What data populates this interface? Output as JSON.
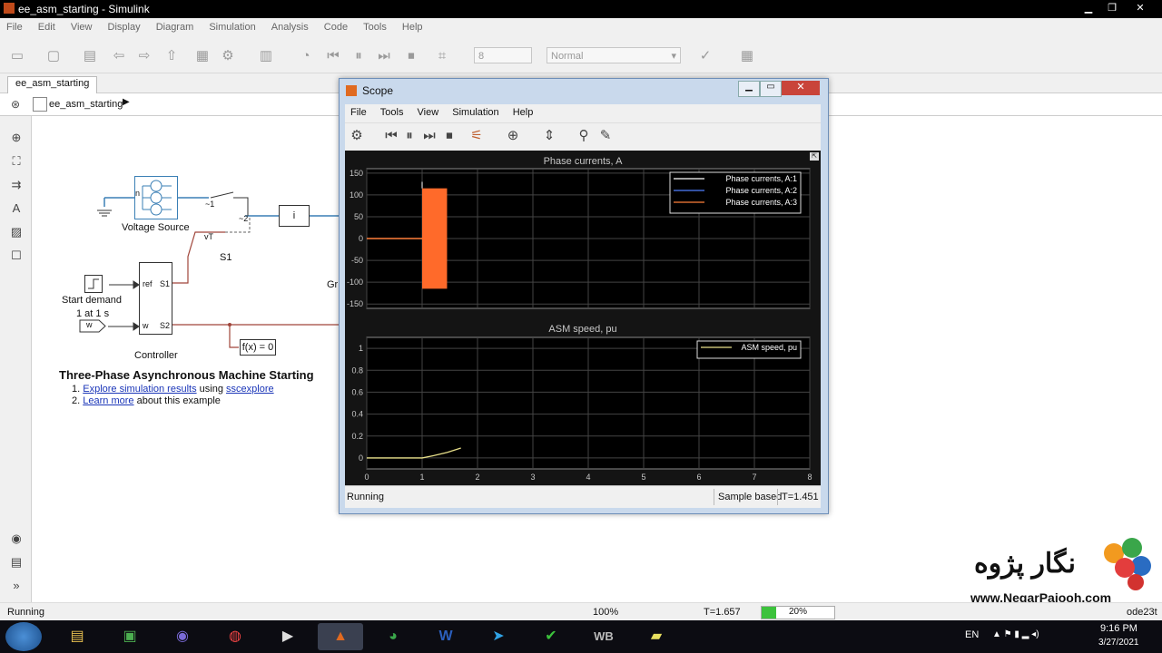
{
  "window": {
    "title": "ee_asm_starting - Simulink"
  },
  "menu": [
    "File",
    "Edit",
    "View",
    "Display",
    "Diagram",
    "Simulation",
    "Analysis",
    "Code",
    "Tools",
    "Help"
  ],
  "toolbar": {
    "stop_time": "8",
    "sim_mode": "Normal"
  },
  "tab": {
    "label": "ee_asm_starting"
  },
  "breadcrumb": {
    "label": "ee_asm_starting"
  },
  "diagram": {
    "voltage_source": "Voltage Source",
    "n_label": "n",
    "switch_1": "~1",
    "switch_2": "~2",
    "vt": "vT",
    "s1": "S1",
    "i_block": "i",
    "gr_label": "Gr",
    "start_demand": "Start demand",
    "one_at": "1 at 1 s",
    "w_label": "w",
    "ctrl_ref": "ref",
    "ctrl_s1": "S1",
    "ctrl_w": "w",
    "ctrl_s2": "S2",
    "controller": "Controller",
    "fx": "f(x) = 0",
    "heading": "Three-Phase Asynchronous Machine Starting",
    "item1_num": "1.",
    "item1_link1": "Explore simulation results",
    "item1_mid": "using",
    "item1_link2": "sscexplore",
    "item2_num": "2.",
    "item2_link": "Learn more",
    "item2_rest": "about this example"
  },
  "status": {
    "left": "Running",
    "zoom": "100%",
    "time": "T=1.657",
    "progress_pct": 20,
    "progress_label": "20%",
    "solver": "ode23t"
  },
  "scope": {
    "title": "Scope",
    "menu": [
      "File",
      "Tools",
      "View",
      "Simulation",
      "Help"
    ],
    "status_left": "Running",
    "status_sample": "Sample based",
    "status_time": "T=1.451"
  },
  "chart_data": [
    {
      "type": "line",
      "title": "Phase currents, A",
      "xlim": [
        0,
        8
      ],
      "ylim": [
        -160,
        160
      ],
      "yticks": [
        -150,
        -100,
        -50,
        0,
        50,
        100,
        150
      ],
      "grid": true,
      "legend_position": "top-right",
      "series": [
        {
          "name": "Phase currents, A:1",
          "color": "#ffffff"
        },
        {
          "name": "Phase currents, A:2",
          "color": "#4f7fff"
        },
        {
          "name": "Phase currents, A:3",
          "color": "#ff7f3a"
        }
      ],
      "pre_start": {
        "x": [
          0,
          1
        ],
        "y": [
          0,
          0
        ]
      },
      "start_spike_peak": 130,
      "oscillation_band": {
        "x_start": 1.0,
        "x_end": 1.45,
        "ymin": -115,
        "ymax": 115
      }
    },
    {
      "type": "line",
      "title": "ASM speed, pu",
      "xlim": [
        0,
        8
      ],
      "ylim": [
        -0.1,
        1.1
      ],
      "yticks": [
        0,
        0.2,
        0.4,
        0.6,
        0.8,
        1
      ],
      "xticks": [
        0,
        1,
        2,
        3,
        4,
        5,
        6,
        7,
        8
      ],
      "grid": true,
      "legend_position": "top-right",
      "series": [
        {
          "name": "ASM speed, pu",
          "color": "#e8e08a",
          "x": [
            0,
            1.0,
            1.2,
            1.45,
            1.7
          ],
          "y": [
            0,
            0,
            0.02,
            0.05,
            0.09
          ]
        }
      ]
    }
  ],
  "watermark": {
    "brand_fa": "نگار پژوه",
    "url": "www.NegarPajooh.com"
  },
  "taskbar": {
    "lang": "EN",
    "clock_time": "9:16 PM",
    "clock_date": "3/27/2021"
  },
  "icons": [
    "simulink-icon",
    "save-icon",
    "back-icon",
    "forward-icon",
    "up-icon",
    "settings-icon",
    "run-icon",
    "pause-icon",
    "step-icon",
    "stop-icon",
    "zoom-icon",
    "windows-start-icon",
    "explorer-icon",
    "matlab-icon",
    "chrome-icon",
    "word-icon",
    "telegram-icon"
  ]
}
